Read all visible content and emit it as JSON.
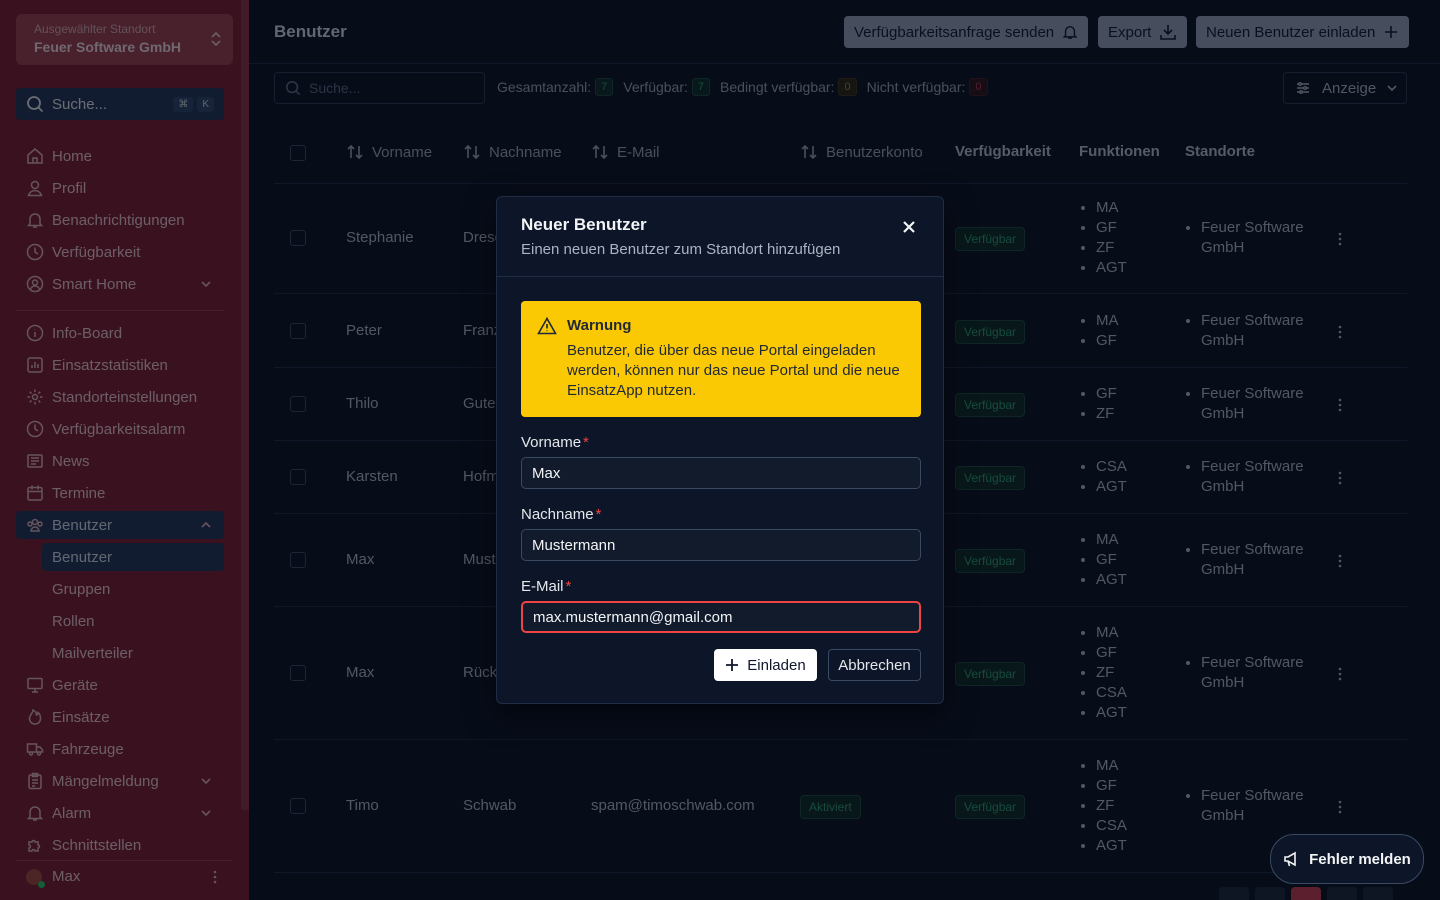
{
  "sidebar": {
    "store_label": "Ausgewählter Standort",
    "store_value": "Feuer Software GmbH",
    "search_label": "Suche...",
    "search_kbd": [
      "⌘",
      "K"
    ],
    "items": [
      {
        "label": "Home",
        "icon": "home-icon"
      },
      {
        "label": "Profil",
        "icon": "user-icon"
      },
      {
        "label": "Benachrichtigungen",
        "icon": "bell-icon"
      },
      {
        "label": "Verfügbarkeit",
        "icon": "clock-icon"
      },
      {
        "label": "Smart Home",
        "icon": "user-circle-icon"
      },
      {
        "label": "Info-Board",
        "icon": "info-icon"
      },
      {
        "label": "Einsatzstatistiken",
        "icon": "bar-chart-icon"
      },
      {
        "label": "Standorteinstellungen",
        "icon": "gear-icon"
      },
      {
        "label": "Verfügbarkeitsalarm",
        "icon": "clock-icon"
      },
      {
        "label": "News",
        "icon": "newspaper-icon"
      },
      {
        "label": "Termine",
        "icon": "calendar-icon"
      },
      {
        "label": "Benutzer",
        "icon": "users-icon"
      },
      {
        "label": "Geräte",
        "icon": "monitor-icon"
      },
      {
        "label": "Einsätze",
        "icon": "flame-icon"
      },
      {
        "label": "Fahrzeuge",
        "icon": "truck-icon"
      },
      {
        "label": "Mängelmeldung",
        "icon": "clipboard-icon"
      },
      {
        "label": "Alarm",
        "icon": "bell-icon"
      },
      {
        "label": "Schnittstellen",
        "icon": "puzzle-icon"
      }
    ],
    "sub_items": [
      "Benutzer",
      "Gruppen",
      "Rollen",
      "Mailverteiler"
    ],
    "user_name": "Max"
  },
  "header": {
    "title": "Benutzer",
    "btn_availability": "Verfügbarkeitsanfrage senden",
    "btn_export": "Export",
    "btn_invite": "Neuen Benutzer einladen"
  },
  "filters": {
    "search_placeholder": "Suche...",
    "total_label": "Gesamtanzahl:",
    "total_value": "7",
    "available_label": "Verfügbar:",
    "available_value": "7",
    "conditional_label": "Bedingt verfügbar:",
    "conditional_value": "0",
    "unavailable_label": "Nicht verfügbar:",
    "unavailable_value": "0",
    "view_label": "Anzeige"
  },
  "table": {
    "columns": [
      "Vorname",
      "Nachname",
      "E-Mail",
      "Benutzerkonto",
      "Verfügbarkeit",
      "Funktionen",
      "Standorte"
    ],
    "rows": [
      {
        "first": "Stephanie",
        "last": "Dresd",
        "email": "",
        "account": "",
        "availability": "Verfügbar",
        "functions": [
          "MA",
          "GF",
          "ZF",
          "AGT"
        ],
        "location": "Feuer Software GmbH"
      },
      {
        "first": "Peter",
        "last": "Franz",
        "email": "",
        "account": "",
        "availability": "Verfügbar",
        "functions": [
          "MA",
          "GF"
        ],
        "location": "Feuer Software GmbH"
      },
      {
        "first": "Thilo",
        "last": "Gute",
        "email": "",
        "account": "",
        "availability": "Verfügbar",
        "functions": [
          "GF",
          "ZF"
        ],
        "location": "Feuer Software GmbH"
      },
      {
        "first": "Karsten",
        "last": "Hofm",
        "email": "",
        "account": "",
        "availability": "Verfügbar",
        "functions": [
          "CSA",
          "AGT"
        ],
        "location": "Feuer Software GmbH"
      },
      {
        "first": "Max",
        "last": "Must",
        "email": "",
        "account": "",
        "availability": "Verfügbar",
        "functions": [
          "MA",
          "GF",
          "AGT"
        ],
        "location": "Feuer Software GmbH"
      },
      {
        "first": "Max",
        "last": "Rück",
        "email": "",
        "account": "",
        "availability": "Verfügbar",
        "functions": [
          "MA",
          "GF",
          "ZF",
          "CSA",
          "AGT"
        ],
        "location": "Feuer Software GmbH"
      },
      {
        "first": "Timo",
        "last": "Schwab",
        "email": "spam@timoschwab.com",
        "account": "Aktiviert",
        "availability": "Verfügbar",
        "functions": [
          "MA",
          "GF",
          "ZF",
          "CSA",
          "AGT"
        ],
        "location": "Feuer Software GmbH"
      }
    ]
  },
  "modal": {
    "title": "Neuer Benutzer",
    "subtitle": "Einen neuen Benutzer zum Standort hinzufügen",
    "warning_title": "Warnung",
    "warning_text": "Benutzer, die über das neue Portal eingeladen werden, können nur das neue Portal und die neue EinsatzApp nutzen.",
    "first_label": "Vorname",
    "first_value": "Max",
    "last_label": "Nachname",
    "last_value": "Mustermann",
    "email_label": "E-Mail",
    "email_value": "max.mustermann@gmail.com",
    "required_mark": "*",
    "invite_label": "Einladen",
    "cancel_label": "Abbrechen"
  },
  "report_label": "Fehler melden",
  "colors": {
    "sidebar": "#7a1c2a",
    "warning": "#fbc804",
    "accent": "#c53b4d",
    "error": "#ef4444"
  }
}
